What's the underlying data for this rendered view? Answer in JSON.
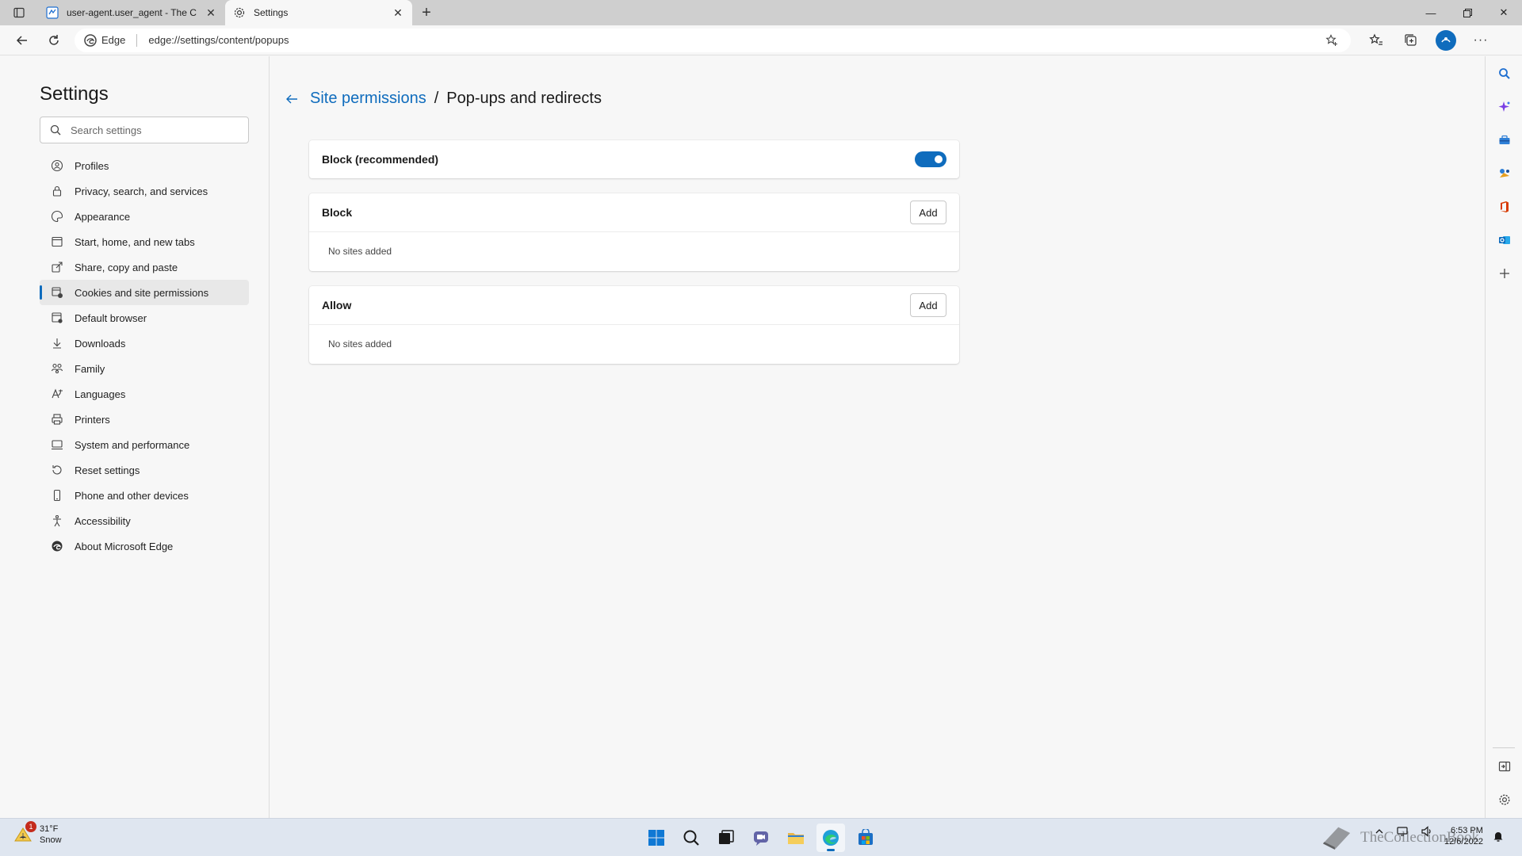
{
  "browser": {
    "tabs": [
      {
        "title": "user-agent.user_agent - The Coll",
        "active": false
      },
      {
        "title": "Settings",
        "active": true
      }
    ],
    "address": {
      "brand": "Edge",
      "url": "edge://settings/content/popups"
    }
  },
  "sidebar": {
    "title": "Settings",
    "search_placeholder": "Search settings",
    "items": [
      {
        "label": "Profiles",
        "icon": "profile-icon"
      },
      {
        "label": "Privacy, search, and services",
        "icon": "lock-icon"
      },
      {
        "label": "Appearance",
        "icon": "palette-icon"
      },
      {
        "label": "Start, home, and new tabs",
        "icon": "home-tabs-icon"
      },
      {
        "label": "Share, copy and paste",
        "icon": "share-icon"
      },
      {
        "label": "Cookies and site permissions",
        "icon": "cookies-icon",
        "selected": true
      },
      {
        "label": "Default browser",
        "icon": "browser-icon"
      },
      {
        "label": "Downloads",
        "icon": "download-icon"
      },
      {
        "label": "Family",
        "icon": "family-icon"
      },
      {
        "label": "Languages",
        "icon": "languages-icon"
      },
      {
        "label": "Printers",
        "icon": "printer-icon"
      },
      {
        "label": "System and performance",
        "icon": "system-icon"
      },
      {
        "label": "Reset settings",
        "icon": "reset-icon"
      },
      {
        "label": "Phone and other devices",
        "icon": "phone-icon"
      },
      {
        "label": "Accessibility",
        "icon": "accessibility-icon"
      },
      {
        "label": "About Microsoft Edge",
        "icon": "edge-icon"
      }
    ]
  },
  "main": {
    "breadcrumb_parent": "Site permissions",
    "breadcrumb_separator": "/",
    "breadcrumb_current": "Pop-ups and redirects",
    "block_recommended": {
      "label": "Block (recommended)",
      "enabled": true
    },
    "block_list": {
      "title": "Block",
      "add_label": "Add",
      "empty_text": "No sites added"
    },
    "allow_list": {
      "title": "Allow",
      "add_label": "Add",
      "empty_text": "No sites added"
    }
  },
  "taskbar": {
    "weather": {
      "temp": "31°F",
      "condition": "Snow",
      "badge": "1"
    },
    "time": "6:53 PM",
    "date": "12/6/2022",
    "watermark": "TheCollectionBook"
  },
  "colors": {
    "accent": "#0f6cbd",
    "page_bg": "#f7f7f7",
    "card_bg": "#ffffff"
  }
}
